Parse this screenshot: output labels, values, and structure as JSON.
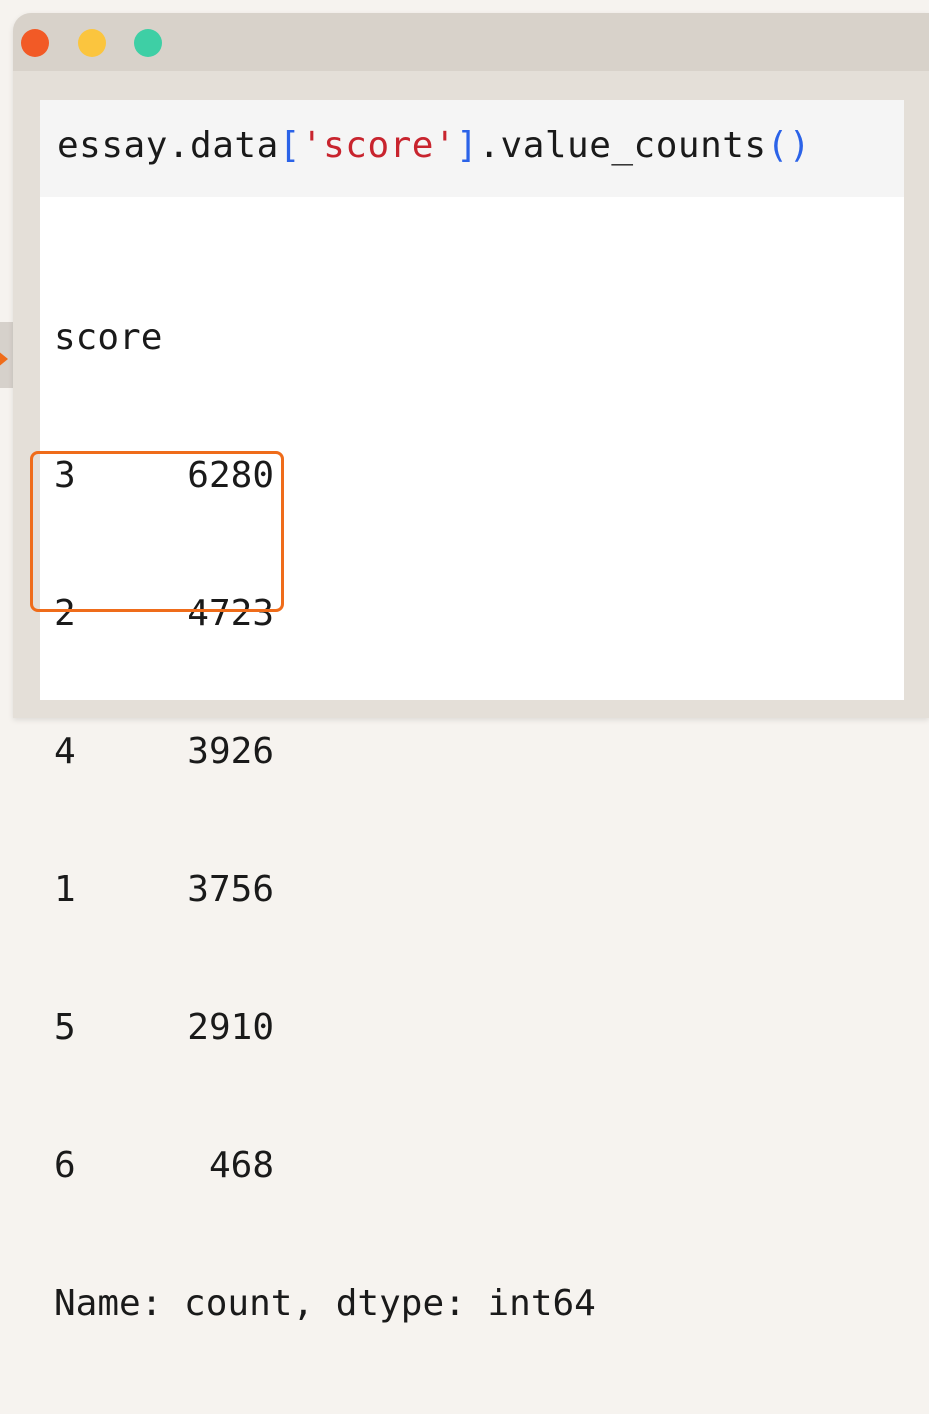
{
  "window": {
    "controls": [
      "close",
      "minimize",
      "maximize"
    ],
    "colors": {
      "close": "#f25a26",
      "minimize": "#fbc53e",
      "maximize": "#3ecfa5",
      "highlight": "#ef6c1a"
    }
  },
  "code_cell": {
    "prefix": "essay.data",
    "open_bracket": "[",
    "string_arg": "'score'",
    "close_bracket": "]",
    "method": ".value_counts",
    "parens": "()"
  },
  "output": {
    "index_name": "score",
    "rows": [
      {
        "key": "3",
        "value": "6280"
      },
      {
        "key": "2",
        "value": "4723"
      },
      {
        "key": "4",
        "value": "3926"
      },
      {
        "key": "1",
        "value": "3756"
      },
      {
        "key": "5",
        "value": "2910"
      },
      {
        "key": "6",
        "value": "468"
      }
    ],
    "footer": "Name: count, dtype: int64"
  }
}
